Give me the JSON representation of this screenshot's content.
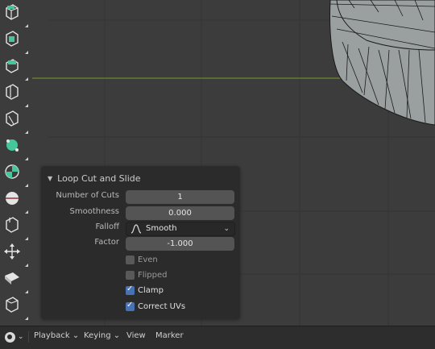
{
  "toolbar": {
    "tools": [
      {
        "name": "extrude-region-icon"
      },
      {
        "name": "extrude-along-normals-icon"
      },
      {
        "name": "inset-faces-icon"
      },
      {
        "name": "bevel-icon"
      },
      {
        "name": "loop-cut-icon"
      },
      {
        "name": "knife-icon"
      },
      {
        "name": "poly-build-icon"
      },
      {
        "name": "spin-icon"
      },
      {
        "name": "smooth-icon"
      },
      {
        "name": "edge-slide-icon"
      },
      {
        "name": "shrink-fatten-icon"
      },
      {
        "name": "shear-icon"
      },
      {
        "name": "rip-region-icon"
      }
    ]
  },
  "operator_panel": {
    "title": "Loop Cut and Slide",
    "fields": {
      "number_of_cuts": {
        "label": "Number of Cuts",
        "value": "1"
      },
      "smoothness": {
        "label": "Smoothness",
        "value": "0.000"
      },
      "falloff": {
        "label": "Falloff",
        "value": "Smooth"
      },
      "factor": {
        "label": "Factor",
        "value": "-1.000"
      }
    },
    "checkboxes": {
      "even": {
        "label": "Even",
        "checked": false
      },
      "flipped": {
        "label": "Flipped",
        "checked": false
      },
      "clamp": {
        "label": "Clamp",
        "checked": true
      },
      "correct_uvs": {
        "label": "Correct UVs",
        "checked": true
      }
    }
  },
  "timeline": {
    "playback": "Playback",
    "keying": "Keying",
    "view": "View",
    "marker": "Marker"
  },
  "colors": {
    "viewport_bg": "#3c3c3c",
    "grid_line": "#353535",
    "x_axis": "#7a9a2a",
    "mesh_face": "#9aa0a0",
    "mesh_edge": "#1a1a1a",
    "tool_green": "#45c79b",
    "checkbox_on": "#4772b3"
  }
}
